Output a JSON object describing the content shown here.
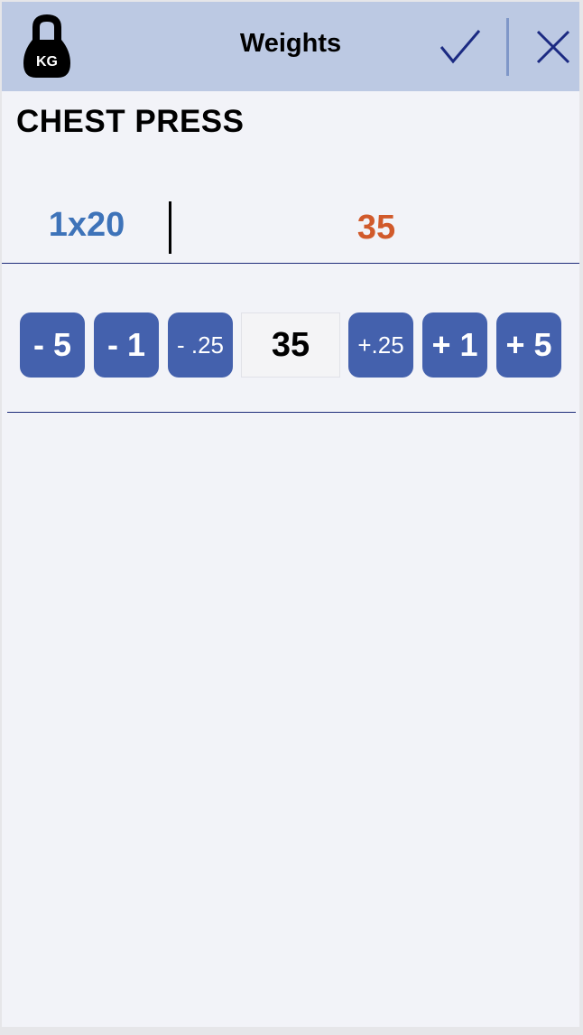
{
  "header": {
    "logo_text": "KG",
    "title": "Weights",
    "confirm_icon": "checkmark-icon",
    "cancel_icon": "close-icon"
  },
  "exercise": {
    "name": "CHEST PRESS",
    "set_scheme": "1x20",
    "current_weight": "35"
  },
  "stepper": {
    "minus_5": "- 5",
    "minus_1": "- 1",
    "minus_quarter": "- .25",
    "value": "35",
    "plus_quarter": "+.25",
    "plus_1": "+ 1",
    "plus_5": "+ 5"
  },
  "colors": {
    "header_bg": "#bcc9e3",
    "button_bg": "#4461ad",
    "set_scheme_text": "#3e73b9",
    "weight_text": "#d15a2b",
    "rule": "#1f2d7a"
  }
}
